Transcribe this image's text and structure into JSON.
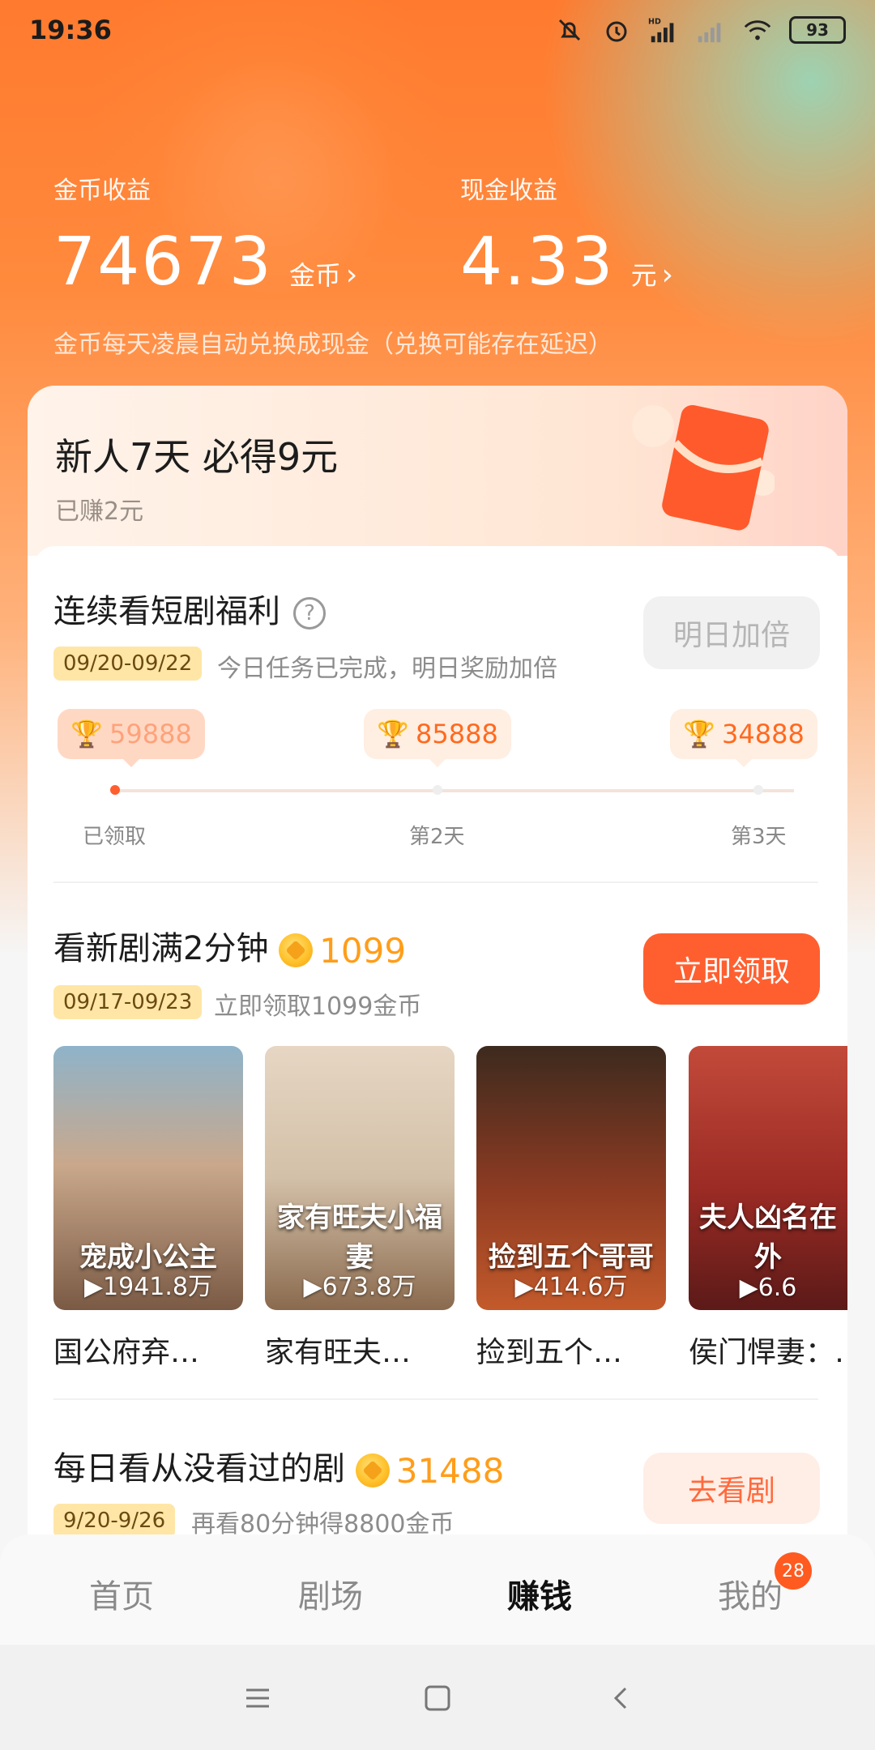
{
  "status_bar": {
    "time": "19:36",
    "network": "HD",
    "battery": "93"
  },
  "earnings": {
    "coins_label": "金币收益",
    "coins_value": "74673",
    "coins_unit": "金币",
    "cash_label": "现金收益",
    "cash_value": "4.33",
    "cash_unit": "元",
    "note": "金币每天凌晨自动兑换成现金（兑换可能存在延迟）",
    "arrow": "›"
  },
  "promo": {
    "title": "新人7天 必得9元",
    "earned": "已赚2元"
  },
  "streak": {
    "title": "连续看短剧福利",
    "help": "?",
    "date_range": "09/20-09/22",
    "desc": "今日任务已完成，明日奖励加倍",
    "button": "明日加倍",
    "milestones": [
      {
        "reward": "59888",
        "label": "已领取"
      },
      {
        "reward": "85888",
        "label": "第2天"
      },
      {
        "reward": "34888",
        "label": "第3天"
      }
    ]
  },
  "new_drama": {
    "title": "看新剧满2分钟",
    "coins": "1099",
    "date_range": "09/17-09/23",
    "desc": "立即领取1099金币",
    "button": "立即领取",
    "dramas": [
      {
        "title": "国公府弃…",
        "views": "▶1941.8万",
        "art": "宠成小公主"
      },
      {
        "title": "家有旺夫…",
        "views": "▶673.8万",
        "art": "家有旺夫小福妻"
      },
      {
        "title": "捡到五个…",
        "views": "▶414.6万",
        "art": "捡到五个哥哥"
      },
      {
        "title": "侯门悍妻：…",
        "views": "▶6.6",
        "art": "夫人凶名在外"
      }
    ]
  },
  "daily": {
    "title": "每日看从没看过的剧",
    "coins": "31488",
    "date_range": "9/20-9/26",
    "desc": "再看80分钟得8800金币",
    "button": "去看剧"
  },
  "nav": {
    "items": [
      "首页",
      "剧场",
      "赚钱",
      "我的"
    ],
    "active": "赚钱",
    "badge": "28"
  },
  "colors": {
    "accent": "#ff5f2f",
    "coin": "#ff9d1a"
  }
}
